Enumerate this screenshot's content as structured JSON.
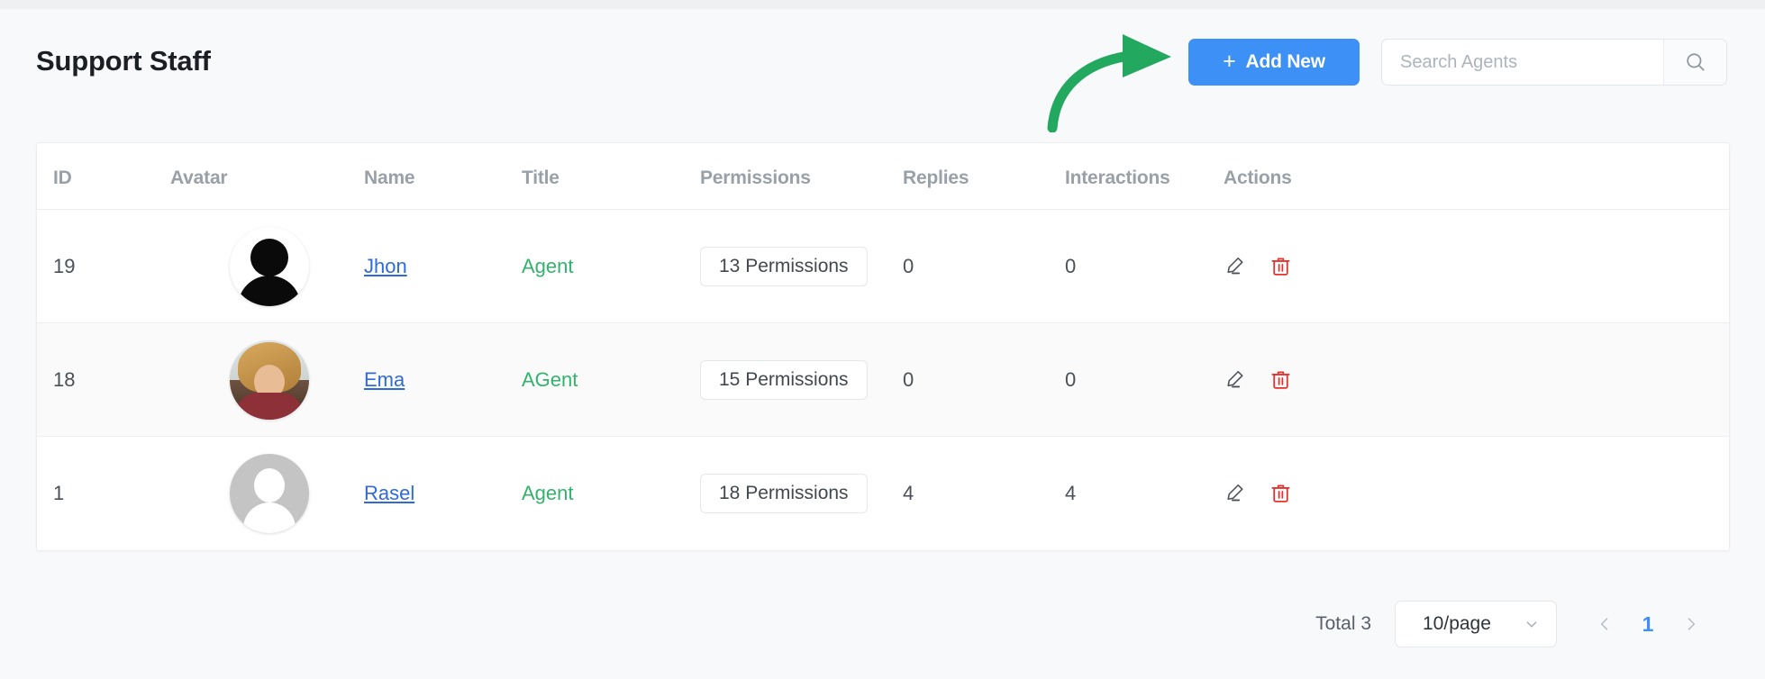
{
  "header": {
    "title": "Support Staff",
    "add_new_label": "Add New",
    "add_icon": "plus-icon",
    "search_placeholder": "Search Agents",
    "search_value": "",
    "search_icon": "search-icon"
  },
  "annotation": {
    "type": "curved-arrow",
    "color": "#23a860",
    "points_to": "add-new-button"
  },
  "table": {
    "columns": [
      "ID",
      "Avatar",
      "Name",
      "Title",
      "Permissions",
      "Replies",
      "Interactions",
      "Actions"
    ],
    "rows": [
      {
        "id": "19",
        "avatar_kind": "black-silhouette",
        "name": "Jhon",
        "title": "Agent",
        "permissions": "13 Permissions",
        "replies": "0",
        "interactions": "0",
        "edit_icon": "pencil-icon",
        "delete_icon": "trash-icon"
      },
      {
        "id": "18",
        "avatar_kind": "photo",
        "name": "Ema",
        "title": "AGent",
        "permissions": "15 Permissions",
        "replies": "0",
        "interactions": "0",
        "edit_icon": "pencil-icon",
        "delete_icon": "trash-icon"
      },
      {
        "id": "1",
        "avatar_kind": "gray-silhouette",
        "name": "Rasel",
        "title": "Agent",
        "permissions": "18 Permissions",
        "replies": "4",
        "interactions": "4",
        "edit_icon": "pencil-icon",
        "delete_icon": "trash-icon"
      }
    ]
  },
  "footer": {
    "total_label": "Total 3",
    "page_size_value": "10/page",
    "page_size_icon": "chevron-down-icon",
    "prev_icon": "chevron-left-icon",
    "next_icon": "chevron-right-icon",
    "current_page": "1"
  },
  "colors": {
    "primary": "#3d90f5",
    "link": "#2f6bd8",
    "title_green": "#34b36c",
    "danger": "#e8302a",
    "annotation_green": "#23a860",
    "page_bg": "#f8f9fb"
  }
}
